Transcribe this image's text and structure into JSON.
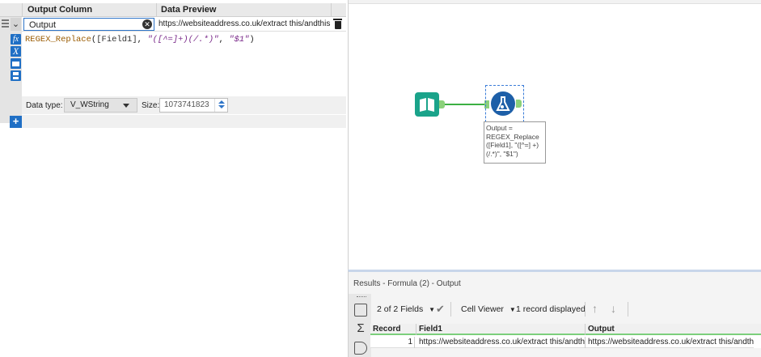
{
  "formula_panel": {
    "columns": {
      "output_column": "Output Column",
      "data_preview": "Data Preview"
    },
    "output_name": "Output",
    "preview_value": "https://websiteaddress.co.uk/extract this/andthis",
    "expression": {
      "func": "REGEX_Replace",
      "open": "(",
      "field": "[Field1]",
      "sep1": ", ",
      "pattern": "\"([^=]+)(/.*)\"",
      "sep2": ", ",
      "replacement": "\"$1\"",
      "close": ")"
    },
    "data_type_label": "Data type:",
    "data_type_value": "V_WString",
    "size_label": "Size:",
    "size_value": "1073741823",
    "side_icons": [
      "fx-icon",
      "variable-x-icon",
      "open-folder-icon",
      "save-icon"
    ]
  },
  "canvas": {
    "tool_annotation": "Output = REGEX_Replace ([Field1], \"([^=] +)(/.*)\", \"$1\")"
  },
  "results": {
    "title": "Results - Formula (2) - Output",
    "fields_selector": "2 of 2 Fields",
    "cell_viewer": "Cell Viewer",
    "records_displayed": "1 record displayed",
    "headers": [
      "Record",
      "Field1",
      "Output"
    ],
    "rows": [
      {
        "record": "1",
        "field1": "https://websiteaddress.co.uk/extract this/andthis...",
        "output": "https://websiteaddress.co.uk/extract this/andthis"
      }
    ]
  },
  "colors": {
    "accent_blue": "#1f6fc5",
    "input_tool_teal": "#1aa38a",
    "connector_green": "#3cb043",
    "formula_tool_blue": "#1d5fa8",
    "func_color": "#9a5b00",
    "string_color": "#7a2a8a"
  }
}
